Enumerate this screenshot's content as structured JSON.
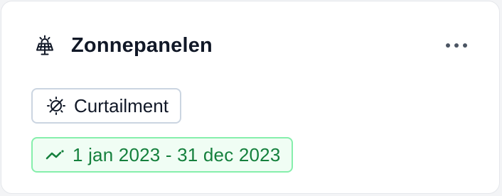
{
  "card": {
    "title": "Zonnepanelen",
    "title_icon": "solar-panel-icon",
    "menu_icon": "more-horizontal-icon"
  },
  "tags": {
    "curtailment": {
      "label": "Curtailment",
      "icon": "sun-off-icon"
    },
    "date_range": {
      "label": "1 jan 2023 - 31 dec 2023",
      "icon": "trend-line-icon",
      "accent_color": "#15803d",
      "border_color": "#86efac",
      "background_color": "#f0fdf4"
    }
  }
}
